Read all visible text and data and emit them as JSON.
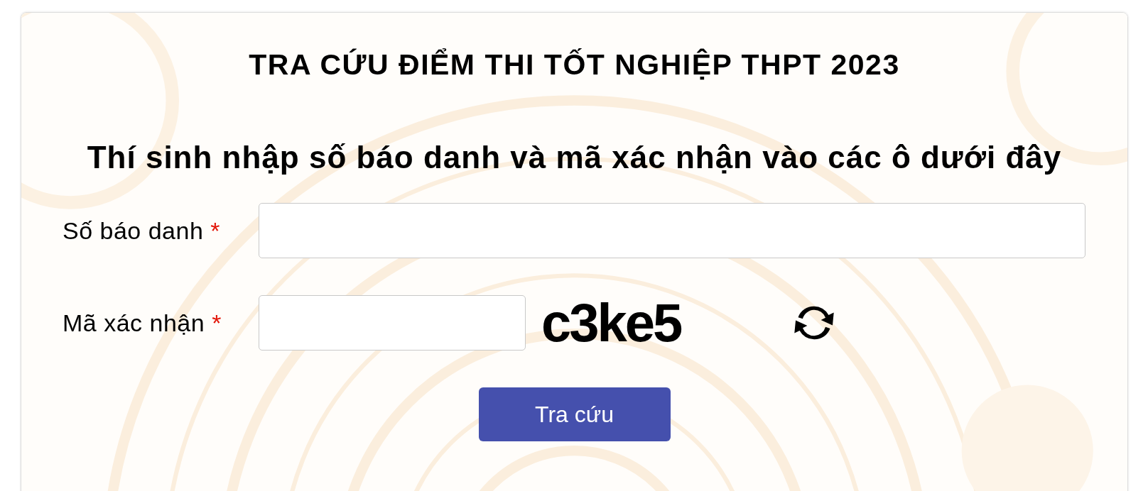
{
  "title": "TRA CỨU ĐIỂM THI TỐT NGHIỆP THPT 2023",
  "instruction": "Thí sinh nhập số báo danh và mã xác nhận vào các ô dưới đây",
  "fields": [
    {
      "kind": "text",
      "label": "Số báo danh",
      "required_mark": "*"
    },
    {
      "kind": "captcha",
      "label": "Mã xác nhận",
      "required_mark": "*",
      "captcha_code": "c3ke5"
    }
  ],
  "submit_button": "Tra cứu"
}
